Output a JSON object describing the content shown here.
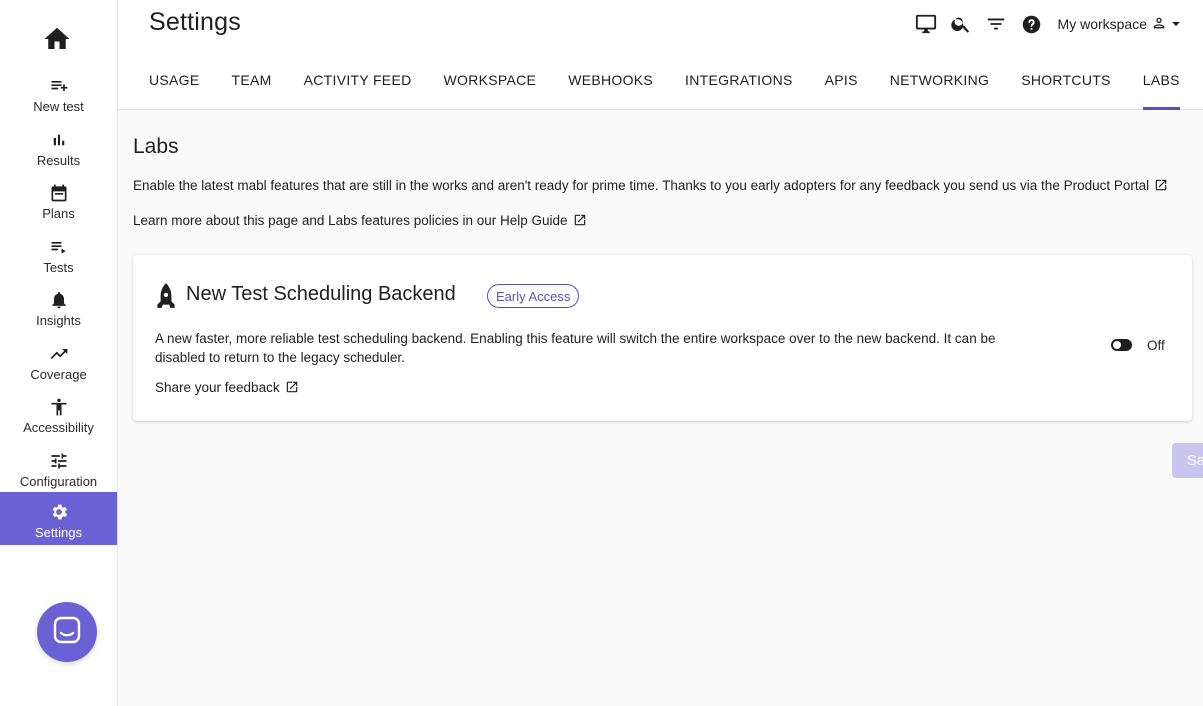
{
  "sidebar": {
    "items": [
      {
        "label": "New test",
        "icon": "playlist-add-icon"
      },
      {
        "label": "Results",
        "icon": "bar-chart-icon"
      },
      {
        "label": "Plans",
        "icon": "calendar-icon"
      },
      {
        "label": "Tests",
        "icon": "playlist-play-icon"
      },
      {
        "label": "Insights",
        "icon": "bell-icon"
      },
      {
        "label": "Coverage",
        "icon": "trending-up-icon"
      },
      {
        "label": "Accessibility",
        "icon": "accessibility-icon"
      },
      {
        "label": "Configuration",
        "icon": "tune-icon"
      },
      {
        "label": "Settings",
        "icon": "gear-icon",
        "active": true
      }
    ]
  },
  "header": {
    "title": "Settings",
    "workspace": "My workspace",
    "tabs": [
      {
        "label": "USAGE"
      },
      {
        "label": "TEAM"
      },
      {
        "label": "ACTIVITY FEED"
      },
      {
        "label": "WORKSPACE"
      },
      {
        "label": "WEBHOOKS"
      },
      {
        "label": "INTEGRATIONS"
      },
      {
        "label": "APIS"
      },
      {
        "label": "NETWORKING"
      },
      {
        "label": "SHORTCUTS"
      },
      {
        "label": "LABS",
        "active": true
      }
    ]
  },
  "labs": {
    "title": "Labs",
    "description": "Enable the latest mabl features that are still in the works and aren't ready for prime time. Thanks to you early adopters for any feedback you send us via the Product Portal",
    "learn_more": "Learn more about this page and Labs features policies in our Help Guide",
    "feature": {
      "title": "New Test Scheduling Backend",
      "badge": "Early Access",
      "description": "A new faster, more reliable test scheduling backend. Enabling this feature will switch the entire workspace over to the new backend. It can be disabled to return to the legacy scheduler.",
      "feedback": "Share your feedback",
      "toggle_label": "Off"
    },
    "save_label": "Save"
  },
  "colors": {
    "accent": "#6a62d4",
    "tab_underline": "#5b4fc7",
    "save_disabled": "#c9c5ee"
  }
}
